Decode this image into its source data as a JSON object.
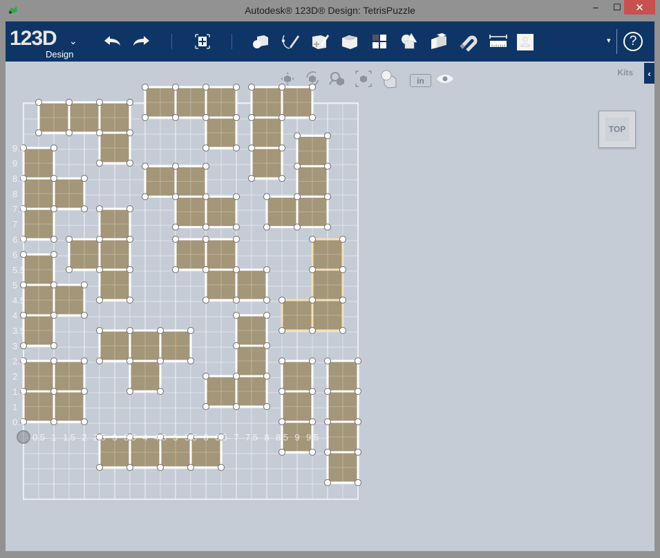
{
  "window": {
    "title": "Autodesk® 123D® Design: TetrisPuzzle",
    "minimize_label": "–",
    "maximize_label": "☐",
    "close_label": "✕"
  },
  "toolbar": {
    "logo_main": "123D",
    "logo_sub": "Design",
    "logo_menu_caret": "ˇ",
    "tools": [
      {
        "name": "undo",
        "icon": "undo-icon"
      },
      {
        "name": "redo",
        "icon": "redo-icon"
      },
      {
        "name": "transform",
        "icon": "transform-icon"
      },
      {
        "name": "primitives",
        "icon": "primitives-icon"
      },
      {
        "name": "sketch",
        "icon": "sketch-icon"
      },
      {
        "name": "construct",
        "icon": "construct-icon"
      },
      {
        "name": "modify",
        "icon": "modify-icon"
      },
      {
        "name": "pattern",
        "icon": "pattern-icon"
      },
      {
        "name": "grouping",
        "icon": "grouping-icon"
      },
      {
        "name": "combine",
        "icon": "combine-icon"
      },
      {
        "name": "snap",
        "icon": "snap-icon"
      },
      {
        "name": "measure",
        "icon": "measure-icon"
      },
      {
        "name": "material",
        "icon": "material-icon"
      }
    ],
    "account_caret": "▾",
    "help_label": "?"
  },
  "viewport": {
    "kits_label": "Kits",
    "kits_tab_label": "‹",
    "viewcube_label": "TOP",
    "units_label": "in",
    "nav_tools": [
      "pan",
      "orbit",
      "zoom",
      "fit",
      "views",
      "units",
      "visibility"
    ]
  },
  "grid": {
    "x_labels": [
      "0.5",
      "1",
      "1.5",
      "2",
      "2.5",
      "3",
      "3.5",
      "4",
      "4.5",
      "5",
      "5.5",
      "6",
      "6.5",
      "7",
      "7.5",
      "8",
      "8.5",
      "9",
      "9.5"
    ],
    "y_labels": [
      "0.5",
      "1",
      "1.5",
      "2",
      "2.5",
      "3",
      "3.5",
      "4",
      "4.5",
      "5",
      "5.5",
      "6",
      "6.5",
      "7",
      "7.5",
      "8",
      "8.5",
      "9",
      "9.5"
    ],
    "piece_color": "#a29274",
    "highlight_color": "#f4dfb5"
  },
  "pieces": [
    {
      "id": "T1",
      "cells": [
        [
          0.5,
          10
        ],
        [
          1.5,
          10
        ],
        [
          2.5,
          10
        ],
        [
          2.5,
          9
        ]
      ]
    },
    {
      "id": "T2",
      "cells": [
        [
          0,
          8.5
        ],
        [
          0,
          7.5
        ],
        [
          1,
          7.5
        ],
        [
          0,
          6.5
        ]
      ]
    },
    {
      "id": "T3",
      "cells": [
        [
          2.5,
          6.5
        ],
        [
          1.5,
          5.5
        ],
        [
          2.5,
          5.5
        ],
        [
          2.5,
          4.5
        ]
      ]
    },
    {
      "id": "T4",
      "cells": [
        [
          0,
          5
        ],
        [
          0,
          4
        ],
        [
          1,
          4
        ],
        [
          0,
          3
        ]
      ]
    },
    {
      "id": "O1",
      "cells": [
        [
          0,
          1.5
        ],
        [
          1,
          1.5
        ],
        [
          0,
          0.5
        ],
        [
          1,
          0.5
        ]
      ]
    },
    {
      "id": "I1",
      "cells": [
        [
          2.5,
          -1
        ],
        [
          3.5,
          -1
        ],
        [
          4.5,
          -1
        ],
        [
          5.5,
          -1
        ]
      ]
    },
    {
      "id": "T5",
      "cells": [
        [
          2.5,
          2.5
        ],
        [
          3.5,
          2.5
        ],
        [
          4.5,
          2.5
        ],
        [
          3.5,
          1.5
        ]
      ]
    },
    {
      "id": "T6",
      "cells": [
        [
          4,
          10.5
        ],
        [
          5,
          10.5
        ],
        [
          6,
          10.5
        ],
        [
          6,
          9.5
        ]
      ]
    },
    {
      "id": "S1",
      "cells": [
        [
          4,
          7.9
        ],
        [
          5,
          7.9
        ],
        [
          5,
          6.9
        ],
        [
          6,
          6.9
        ]
      ]
    },
    {
      "id": "Z1",
      "cells": [
        [
          5,
          5.5
        ],
        [
          6,
          5.5
        ],
        [
          6,
          4.5
        ],
        [
          7,
          4.5
        ]
      ]
    },
    {
      "id": "J1",
      "cells": [
        [
          7,
          3
        ],
        [
          7,
          2
        ],
        [
          6,
          1
        ],
        [
          7,
          1
        ]
      ]
    },
    {
      "id": "L1",
      "cells": [
        [
          7.5,
          10.5
        ],
        [
          8.5,
          10.5
        ],
        [
          7.5,
          9.5
        ],
        [
          7.5,
          8.5
        ]
      ]
    },
    {
      "id": "J2",
      "cells": [
        [
          9,
          8.9
        ],
        [
          9,
          7.9
        ],
        [
          8,
          6.9
        ],
        [
          9,
          6.9
        ]
      ]
    },
    {
      "id": "J3",
      "cells": [
        [
          9.5,
          5.5
        ],
        [
          9.5,
          4.5
        ],
        [
          8.5,
          3.5
        ],
        [
          9.5,
          3.5
        ]
      ],
      "highlighted": true
    },
    {
      "id": "I2",
      "cells": [
        [
          8.5,
          1.5
        ],
        [
          8.5,
          0.5
        ],
        [
          8.5,
          -0.5
        ]
      ]
    },
    {
      "id": "I3",
      "cells": [
        [
          10,
          1.5
        ],
        [
          10,
          0.5
        ],
        [
          10,
          -0.5
        ],
        [
          10,
          -1.5
        ]
      ]
    }
  ]
}
